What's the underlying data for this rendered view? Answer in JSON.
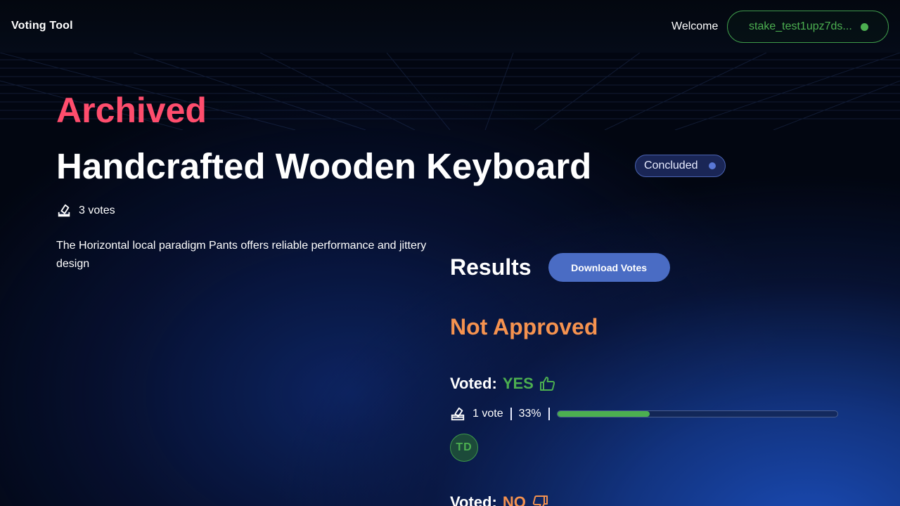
{
  "header": {
    "brand": "Voting Tool",
    "welcome": "Welcome",
    "wallet_address": "stake_test1upz7ds...",
    "wallet_status_color": "#4caf50"
  },
  "proposal": {
    "state_label": "Archived",
    "title": "Handcrafted Wooden Keyboard",
    "status_badge": "Concluded",
    "total_votes": "3 votes",
    "description": "The Horizontal local paradigm Pants offers reliable performance and jittery design"
  },
  "results": {
    "heading": "Results",
    "download_label": "Download Votes",
    "outcome": "Not Approved",
    "yes": {
      "voted_label": "Voted:",
      "value": "YES",
      "vote_count": "1 vote",
      "percent_text": "33%",
      "progress_fraction": 0.33,
      "voters": [
        "TD"
      ],
      "color": "#4caf50"
    },
    "no": {
      "voted_label": "Voted:",
      "value": "NO",
      "color": "#f5924f"
    }
  },
  "colors": {
    "archived": "#ff4d6d",
    "outcome": "#f5924f",
    "accent_button": "#4a6cc4",
    "badge_dot": "#5a78d6"
  }
}
